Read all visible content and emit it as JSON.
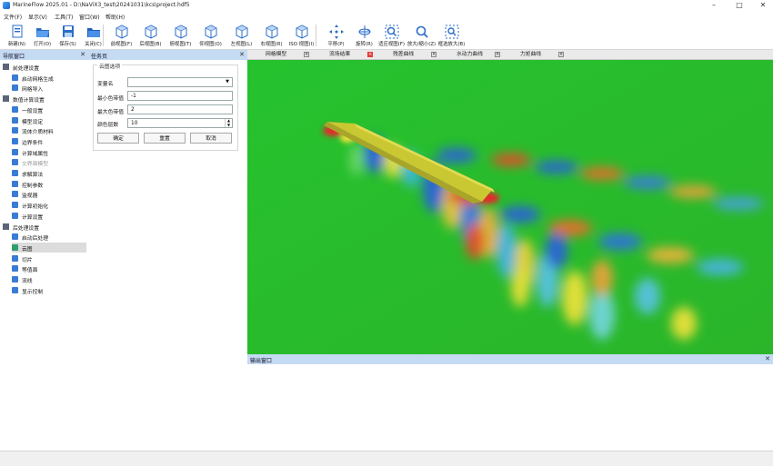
{
  "window": {
    "title": "MarineFlow 2025.01 - D:\\NaViX3_test\\20241031\\kcs\\project.hdf5"
  },
  "menu": [
    "文件(F)",
    "显示(V)",
    "工具(T)",
    "窗口(W)",
    "帮助(H)"
  ],
  "toolbar": [
    {
      "label": "新建(N)",
      "icon": "new-file-icon"
    },
    {
      "label": "打开(O)",
      "icon": "open-folder-icon"
    },
    {
      "label": "保存(S)",
      "icon": "save-icon"
    },
    {
      "label": "关闭(C)",
      "icon": "close-file-icon"
    },
    {
      "label": "前视图(F)",
      "icon": "front-view-icon"
    },
    {
      "label": "后视图(B)",
      "icon": "back-view-icon"
    },
    {
      "label": "俯视图(T)",
      "icon": "top-view-icon"
    },
    {
      "label": "仰视图(O)",
      "icon": "bottom-view-icon"
    },
    {
      "label": "左视图(L)",
      "icon": "left-view-icon"
    },
    {
      "label": "右视图(R)",
      "icon": "right-view-icon"
    },
    {
      "label": "ISO 视图(I)",
      "icon": "iso-view-icon"
    },
    {
      "label": "平移(P)",
      "icon": "pan-icon"
    },
    {
      "label": "旋转(R)",
      "icon": "rotate-icon"
    },
    {
      "label": "适应视图(F)",
      "icon": "fit-view-icon"
    },
    {
      "label": "放大/缩小(Z)",
      "icon": "zoom-icon"
    },
    {
      "label": "框选放大(B)",
      "icon": "box-zoom-icon"
    }
  ],
  "nav": {
    "title": "导航窗口",
    "items": [
      {
        "label": "前处理设置",
        "level": 0,
        "icon": "folder-icon"
      },
      {
        "label": "启动网格生成",
        "level": 1,
        "icon": "mesh-gen-icon"
      },
      {
        "label": "网格导入",
        "level": 1,
        "icon": "mesh-import-icon"
      },
      {
        "label": "数值计算设置",
        "level": 0,
        "icon": "folder-icon"
      },
      {
        "label": "一般设置",
        "level": 1,
        "icon": "settings-icon"
      },
      {
        "label": "模型设定",
        "level": 1,
        "icon": "model-icon"
      },
      {
        "label": "流体介质材料",
        "level": 1,
        "icon": "material-icon"
      },
      {
        "label": "边界条件",
        "level": 1,
        "icon": "boundary-icon"
      },
      {
        "label": "计算域属性",
        "level": 1,
        "icon": "domain-icon"
      },
      {
        "label": "交界面模型",
        "level": 1,
        "icon": "interface-icon",
        "dim": true
      },
      {
        "label": "求解算法",
        "level": 1,
        "icon": "solver-icon"
      },
      {
        "label": "控制参数",
        "level": 1,
        "icon": "control-icon"
      },
      {
        "label": "监视器",
        "level": 1,
        "icon": "monitor-icon"
      },
      {
        "label": "计算初始化",
        "level": 1,
        "icon": "init-icon"
      },
      {
        "label": "计算设置",
        "level": 1,
        "icon": "calc-icon"
      },
      {
        "label": "后处理设置",
        "level": 0,
        "icon": "folder-icon"
      },
      {
        "label": "启动后处理",
        "level": 1,
        "icon": "post-icon"
      },
      {
        "label": "云图",
        "level": 1,
        "icon": "contour-icon",
        "selected": true
      },
      {
        "label": "切片",
        "level": 1,
        "icon": "slice-icon"
      },
      {
        "label": "等值面",
        "level": 1,
        "icon": "isosurface-icon"
      },
      {
        "label": "流线",
        "level": 1,
        "icon": "streamline-icon"
      },
      {
        "label": "显示控制",
        "level": 1,
        "icon": "display-icon"
      }
    ]
  },
  "task": {
    "title": "任务页",
    "group_title": "云图选项",
    "variable_label": "变量名",
    "variable_value": "",
    "min_label": "最小色带值",
    "min_value": "-1",
    "max_label": "最大色带值",
    "max_value": "2",
    "levels_label": "颜色层数",
    "levels_value": "10",
    "ok": "确定",
    "reset": "重置",
    "cancel": "取消"
  },
  "tabs": [
    {
      "label": "网格模型",
      "active": false
    },
    {
      "label": "流场结果",
      "active": true
    },
    {
      "label": "残差曲线",
      "active": false
    },
    {
      "label": "水动力曲线",
      "active": false
    },
    {
      "label": "力矩曲线",
      "active": false
    }
  ],
  "output": {
    "title": "输出窗口"
  }
}
